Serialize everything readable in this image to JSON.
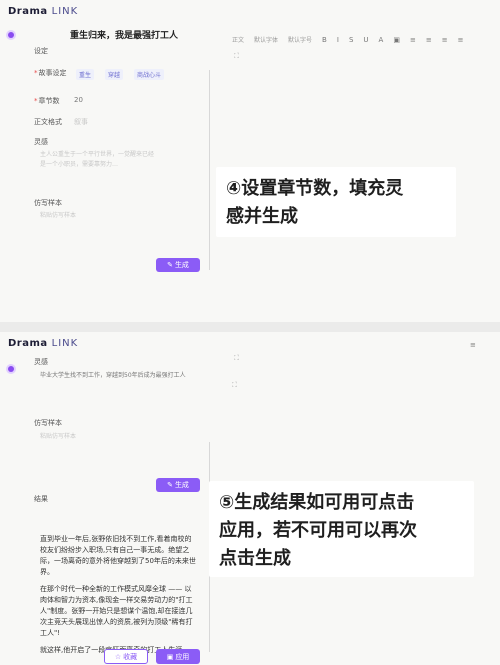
{
  "brand": {
    "word1": "Drama",
    "word2": "LINK"
  },
  "screen1": {
    "title": "重生归来，我是最强打工人",
    "settings_label": "设定",
    "story_setting_label": "故事设定",
    "story_tags": [
      "重生",
      "穿越",
      "商战心斗"
    ],
    "chapters_label": "章节数",
    "chapters_value": "20",
    "format_label": "正文格式",
    "format_value": "叙事",
    "inspiration_label": "灵感",
    "inspiration_placeholder_lines": [
      "主人公重生于一个平行世界，一觉醒来已经",
      "是一个小职员，需要靠努力…"
    ],
    "imitation_label": "仿写样本",
    "imitation_placeholder": "粘贴仿写样本",
    "generate_label": "生成"
  },
  "toolbar": {
    "items": [
      "正文",
      "默认字体",
      "默认字号"
    ],
    "icons": [
      "bold-icon",
      "italic-icon",
      "strike-icon",
      "underline-icon",
      "color-icon",
      "image-icon",
      "align-left-icon",
      "align-center-icon",
      "align-right-icon",
      "align-justify-icon"
    ],
    "glyphs": [
      "B",
      "I",
      "S",
      "U",
      "A",
      "▣",
      "≡",
      "≡",
      "≡",
      "≡"
    ]
  },
  "callout1": {
    "line1": "④设置章节数，填充灵",
    "line2": "感并生成"
  },
  "screen2": {
    "inspiration_label": "灵感",
    "inspiration_text": "毕业大学生找不到工作，穿越到50年后成为最强打工人",
    "imitation_label": "仿写样本",
    "imitation_placeholder": "粘贴仿写样本",
    "generate_label": "生成",
    "result_label": "结果",
    "result_paragraphs": [
      "直到毕业一年后,张野依旧找不到工作,看着南校的校友们纷纷步入职场,只有自己一事无成。绝望之际，一场离奇的意外将他穿越到了50年后的未来世界。",
      "在那个时代一种全新的工作模式风靡全球 —— 以肉体和智力为资本,像现金一样交易劳动力的\"打工人\"制度。张野一开始只是想谋个温饱,却在接连几次主竞天头展现出惊人的资质,被列为顶级\"稀有打工人\"!",
      "就这样,他开启了一段疯狂而离奇的打工人生涯。"
    ],
    "collect_label": "收藏",
    "apply_label": "应用"
  },
  "callout2": {
    "line1": "⑤生成结果如可用可点击",
    "line2": "应用，若不可用可以再次",
    "line3": "点击生成"
  }
}
